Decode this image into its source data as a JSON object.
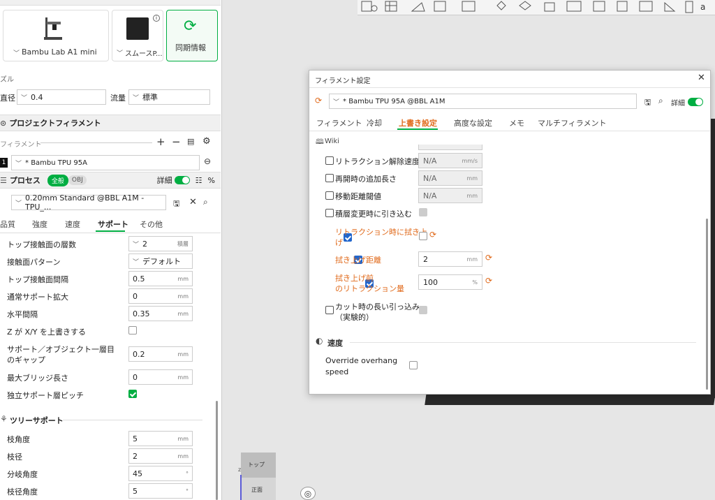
{
  "colors": {
    "accent": "#00ae42",
    "modified": "#e06a1b",
    "checkbox": "#2266cc"
  },
  "printer": {
    "name": "Bambu Lab A1 mini",
    "plate": "スムースP...",
    "sync": "同期情報"
  },
  "nozzle": {
    "section": "ズル",
    "diameter_label": "直径",
    "diameter_value": "0.4",
    "flow_label": "流量",
    "flow_value": "標準"
  },
  "project_filament": {
    "title": "プロジェクトフィラメント",
    "filament_label": "フィラメント",
    "index": "1",
    "filament": "* Bambu TPU 95A"
  },
  "process": {
    "title": "プロセス",
    "mode_all": "全般",
    "mode_obj": "OBJ",
    "detail": "詳細",
    "preset": "0.20mm Standard @BBL A1M -TPU_...",
    "tabs": [
      "品質",
      "強度",
      "速度",
      "サポート",
      "その他"
    ]
  },
  "support_rows": [
    {
      "label": "トップ接触面の層数",
      "value": "2",
      "unit": "積層",
      "select": true
    },
    {
      "label": "接触面パターン",
      "value": "デフォルト",
      "unit": "",
      "select": true
    },
    {
      "label": "トップ接触面間隔",
      "value": "0.5",
      "unit": "mm"
    },
    {
      "label": "通常サポート拡大",
      "value": "0",
      "unit": "mm"
    },
    {
      "label": "水平間隔",
      "value": "0.35",
      "unit": "mm"
    },
    {
      "label": "Z が X/Y を上書きする",
      "checkbox": false
    },
    {
      "label": "サポート／オブジェクト一層目",
      "label2": "のギャップ",
      "value": "0.2",
      "unit": "mm"
    },
    {
      "label": "最大ブリッジ長さ",
      "value": "0",
      "unit": "mm"
    },
    {
      "label": "独立サポート層ピッチ",
      "checkbox": true
    }
  ],
  "tree_support": {
    "title": "ツリーサポート",
    "rows": [
      {
        "label": "枝角度",
        "value": "5",
        "unit": "mm"
      },
      {
        "label": "枝径",
        "value": "2",
        "unit": "mm"
      },
      {
        "label": "分岐角度",
        "value": "45",
        "unit": "°"
      },
      {
        "label": "枝径角度",
        "value": "5",
        "unit": "°"
      }
    ]
  },
  "dialog": {
    "title": "フィラメント設定",
    "preset": "* Bambu TPU 95A @BBL A1M",
    "detail": "詳細",
    "tabs": [
      "フィラメント",
      "冷却",
      "上書き設定",
      "高度な設定",
      "メモ",
      "マルチフィラメント"
    ],
    "wiki": "Wiki",
    "rows": [
      {
        "label": "リトラクション解除速度",
        "value": "N/A",
        "unit": "mm/s",
        "checked": false,
        "na": true
      },
      {
        "label": "再開時の追加長さ",
        "value": "N/A",
        "unit": "mm",
        "checked": false,
        "na": true
      },
      {
        "label": "移動距離閾値",
        "value": "N/A",
        "unit": "mm",
        "checked": false,
        "na": true
      },
      {
        "label": "積層変更時に引き込む",
        "checked": false
      },
      {
        "label": "リトラクション時に拭き上",
        "label2": "げ",
        "checked": true
      },
      {
        "label": "拭き上げ距離",
        "value": "2",
        "unit": "mm",
        "checked": true
      },
      {
        "label": "拭き上げ前",
        "label2": "のリトラクション量",
        "value": "100",
        "unit": "%",
        "checked": true
      },
      {
        "label": "カット時の長い引っ込み",
        "label2": "（実験的）",
        "checked": false
      }
    ],
    "speed_section": "速度",
    "override_label": "Override overhang",
    "override_label2": "speed"
  },
  "viewport": {
    "cube_top": "トップ",
    "cube_front": "正面",
    "axis": "z",
    "letter": "a"
  }
}
